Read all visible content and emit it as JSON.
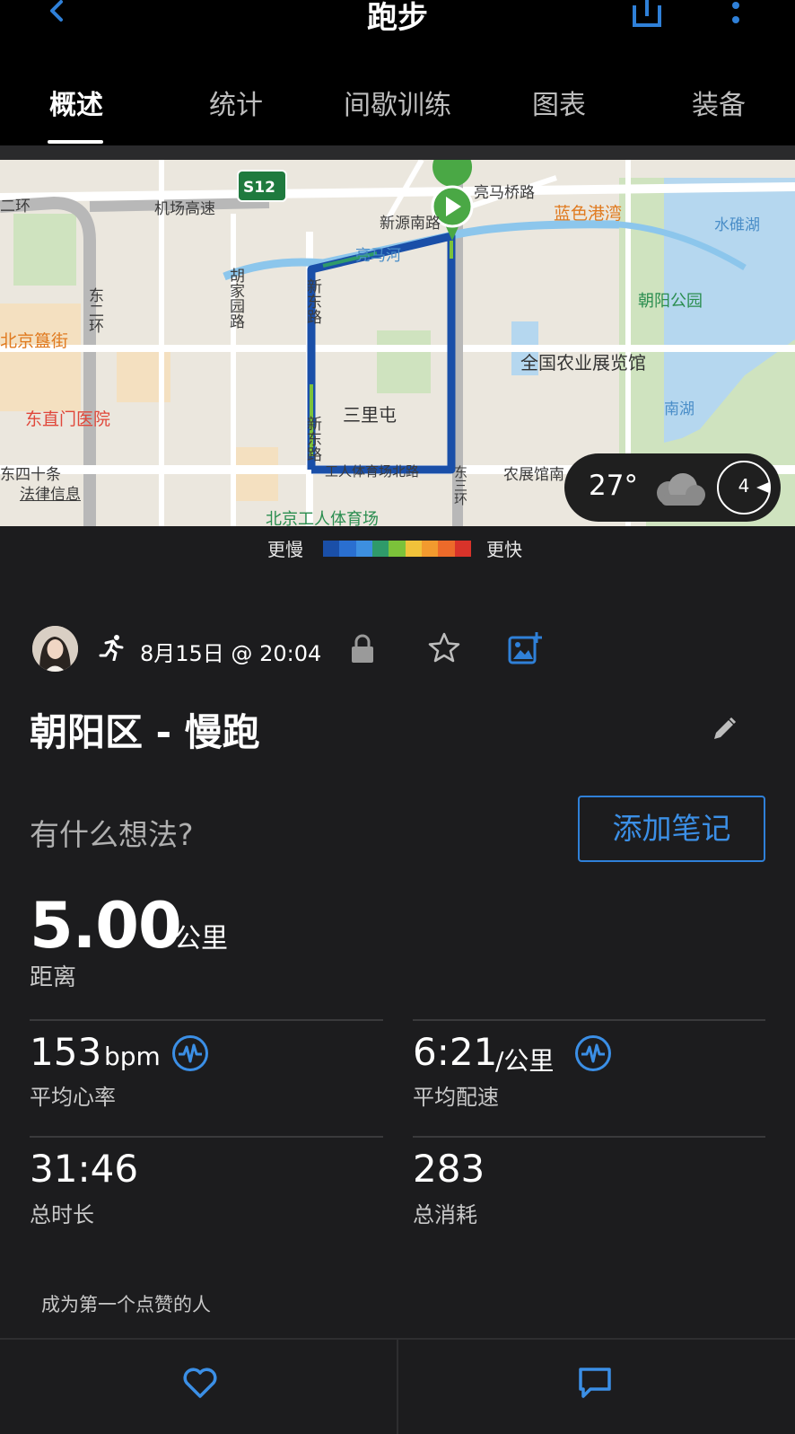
{
  "header": {
    "title": "跑步",
    "back_icon": "chevron-left-icon",
    "share_icon": "share-icon",
    "more_icon": "more-vertical-icon"
  },
  "tabs": [
    {
      "label": "概述",
      "active": true
    },
    {
      "label": "统计"
    },
    {
      "label": "间歇训练"
    },
    {
      "label": "图表"
    },
    {
      "label": "装备"
    }
  ],
  "map": {
    "labels": {
      "ring2": "二环",
      "airport": "机场高速",
      "s12": "S12",
      "xinyuan": "新源南路",
      "liangmaqiao": "亮马桥路",
      "lanse": "蓝色港湾",
      "shuidui": "水碓湖",
      "liangmahe": "亮马河",
      "hujia": "胡家园路",
      "xindong1": "新东路",
      "dongerhuan": "东二环",
      "chaoyang_park": "朝阳公园",
      "guijie": "北京簋街",
      "nongzhan": "全国农业展览馆",
      "sanlitun": "三里屯",
      "dongzhimen": "东直门医院",
      "nanhu": "南湖",
      "xindong2": "新东路",
      "dongsishi": "东四十条",
      "gongti_north": "工人体育场北路",
      "dongsanhuan": "东三环",
      "nongzhan_nan": "农展馆南",
      "legal": "法律信息",
      "gongti": "北京工人体育场"
    },
    "weather": {
      "temp": "27°",
      "icon": "cloud-icon",
      "wind_value": "4"
    }
  },
  "legend": {
    "slow": "更慢",
    "fast": "更快",
    "colors": [
      "#1a4fa8",
      "#2a6fd0",
      "#3d8fe0",
      "#2f9a6a",
      "#7cc23a",
      "#f0c23a",
      "#f29a2e",
      "#ec6a2a",
      "#d8332a"
    ]
  },
  "activity": {
    "date": "8月15日 @ 20:04",
    "title": "朝阳区 - 慢跑",
    "thoughts_placeholder": "有什么想法?",
    "add_note": "添加笔记"
  },
  "stats": {
    "distance": {
      "value": "5.00",
      "unit": "公里",
      "label": "距离"
    },
    "heart_rate": {
      "value": "153",
      "unit": "bpm",
      "label": "平均心率"
    },
    "pace": {
      "value": "6:21",
      "unit": "/公里",
      "label": "平均配速"
    },
    "duration": {
      "value": "31:46",
      "label": "总时长"
    },
    "calories": {
      "value": "283",
      "label": "总消耗"
    }
  },
  "social": {
    "likes_text": "成为第一个点赞的人",
    "like_icon": "heart-icon",
    "comment_icon": "comment-icon"
  },
  "colors": {
    "accent": "#2f80d8",
    "background": "#1c1c1e",
    "header": "#000000"
  }
}
